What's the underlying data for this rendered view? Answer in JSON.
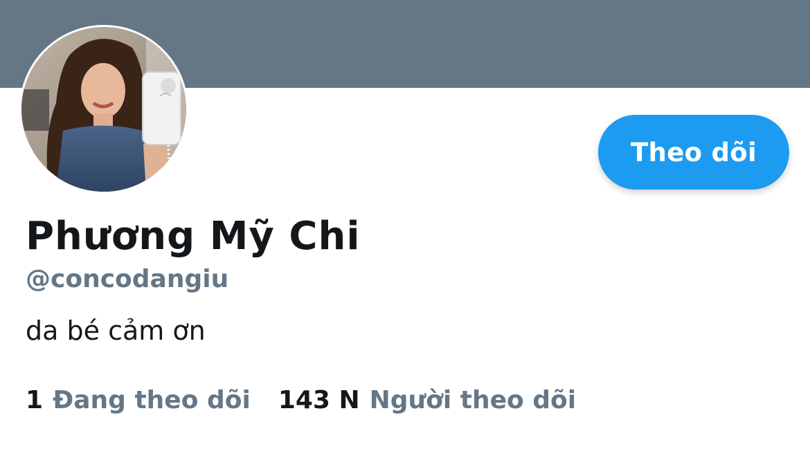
{
  "profile": {
    "banner_color": "#657786",
    "display_name": "Phương Mỹ Chi",
    "handle": "@concodangiu",
    "bio": "da bé cảm ơn",
    "avatar_alt": "profile photo"
  },
  "actions": {
    "follow_label": "Theo dõi",
    "follow_color": "#1d9bf0"
  },
  "stats": {
    "following_count": "1",
    "following_label": "Đang theo dõi",
    "followers_count": "143 N",
    "followers_label": "Người theo dõi"
  },
  "colors": {
    "secondary_text": "#657786",
    "primary_text": "#14171a"
  }
}
